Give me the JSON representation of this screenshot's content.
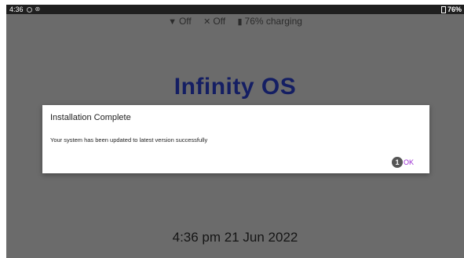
{
  "statusbar": {
    "time": "4:36",
    "battery": "76%",
    "left_icons": [
      "circle-icon",
      "sync-icon"
    ]
  },
  "quick_status": {
    "wifi_label": "Off",
    "bluetooth_label": "Off",
    "battery_label": "76% charging"
  },
  "home": {
    "title": "Infinity OS",
    "clock": "4:36 pm  21 Jun 2022"
  },
  "dialog": {
    "title": "Installation Complete",
    "message": "Your system has been updated to latest version successfully",
    "ok_badge": "1",
    "ok_label": "OK"
  },
  "colors": {
    "dim_background": "#6b6b6b",
    "title_color": "#141e63",
    "ok_color": "#9a2bd1"
  }
}
